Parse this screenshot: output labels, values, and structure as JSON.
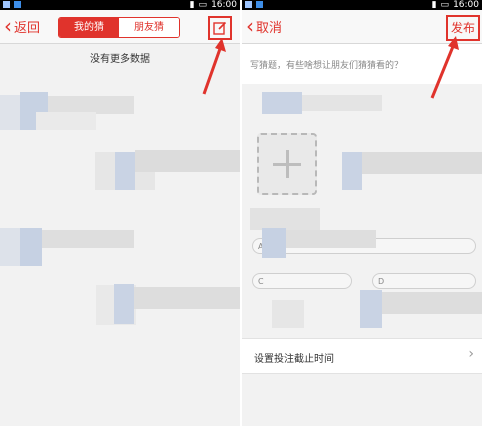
{
  "status_bar": {
    "time": "16:00"
  },
  "left_screen": {
    "back_label": "返回",
    "tabs": [
      "我的猜",
      "朋友猜"
    ],
    "empty_message": "没有更多数据"
  },
  "right_screen": {
    "cancel_label": "取消",
    "publish_label": "发布",
    "prompt_placeholder": "写猜题，有些啥想让朋友们猜猜看的？",
    "options": [
      "A",
      "C",
      "D"
    ],
    "deadline_label": "设置投注截止时间"
  },
  "colors": {
    "accent": "#e0332c",
    "background": "#f2f2f2"
  },
  "icons": {
    "edit": "edit-icon",
    "back": "chevron-left-icon",
    "add_photo": "plus-icon",
    "arrow": "chevron-right-icon"
  }
}
